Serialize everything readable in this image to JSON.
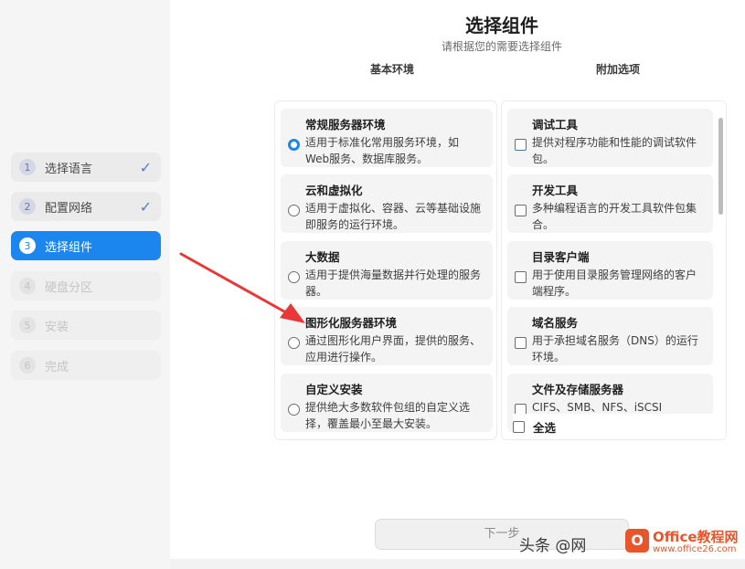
{
  "steps": [
    {
      "num": "1",
      "label": "选择语言",
      "status": "done"
    },
    {
      "num": "2",
      "label": "配置网络",
      "status": "done"
    },
    {
      "num": "3",
      "label": "选择组件",
      "status": "active"
    },
    {
      "num": "4",
      "label": "硬盘分区",
      "status": "disabled"
    },
    {
      "num": "5",
      "label": "安装",
      "status": "disabled"
    },
    {
      "num": "6",
      "label": "完成",
      "status": "disabled"
    }
  ],
  "check_glyph": "✓",
  "header": {
    "title": "选择组件",
    "subtitle": "请根据您的需要选择组件",
    "left_col": "基本环境",
    "right_col": "附加选项"
  },
  "environments": [
    {
      "name": "常规服务器环境",
      "desc": "适用于标准化常用服务环境，如Web服务、数据库服务。",
      "selected": true
    },
    {
      "name": "云和虚拟化",
      "desc": "适用于虚拟化、容器、云等基础设施即服务的运行环境。",
      "selected": false
    },
    {
      "name": "大数据",
      "desc": "适用于提供海量数据并行处理的服务器。",
      "selected": false
    },
    {
      "name": "图形化服务器环境",
      "desc": "通过图形化用户界面，提供的服务、应用进行操作。",
      "selected": false
    },
    {
      "name": "自定义安装",
      "desc": "提供绝大多数软件包组的自定义选择，覆盖最小至最大安装。",
      "selected": false
    }
  ],
  "addons": [
    {
      "name": "调试工具",
      "desc": "提供对程序功能和性能的调试软件包。",
      "checked": false
    },
    {
      "name": "开发工具",
      "desc": "多种编程语言的开发工具软件包集合。",
      "checked": false
    },
    {
      "name": "目录客户端",
      "desc": "用于使用目录服务管理网络的客户端程序。",
      "checked": false
    },
    {
      "name": "域名服务",
      "desc": "用于承担域名服务（DNS）的运行环境。",
      "checked": false
    },
    {
      "name": "文件及存储服务器",
      "desc": "CIFS、SMB、NFS、iSCSI",
      "checked": false
    }
  ],
  "select_all": "全选",
  "next_button": "下一步",
  "watermark": {
    "text": "头条 @网",
    "logo_letter": "O",
    "brand": "Office教程网",
    "url": "www.office26.com"
  },
  "colors": {
    "accent": "#1a86ee",
    "annotation_arrow": "#e8393a"
  }
}
